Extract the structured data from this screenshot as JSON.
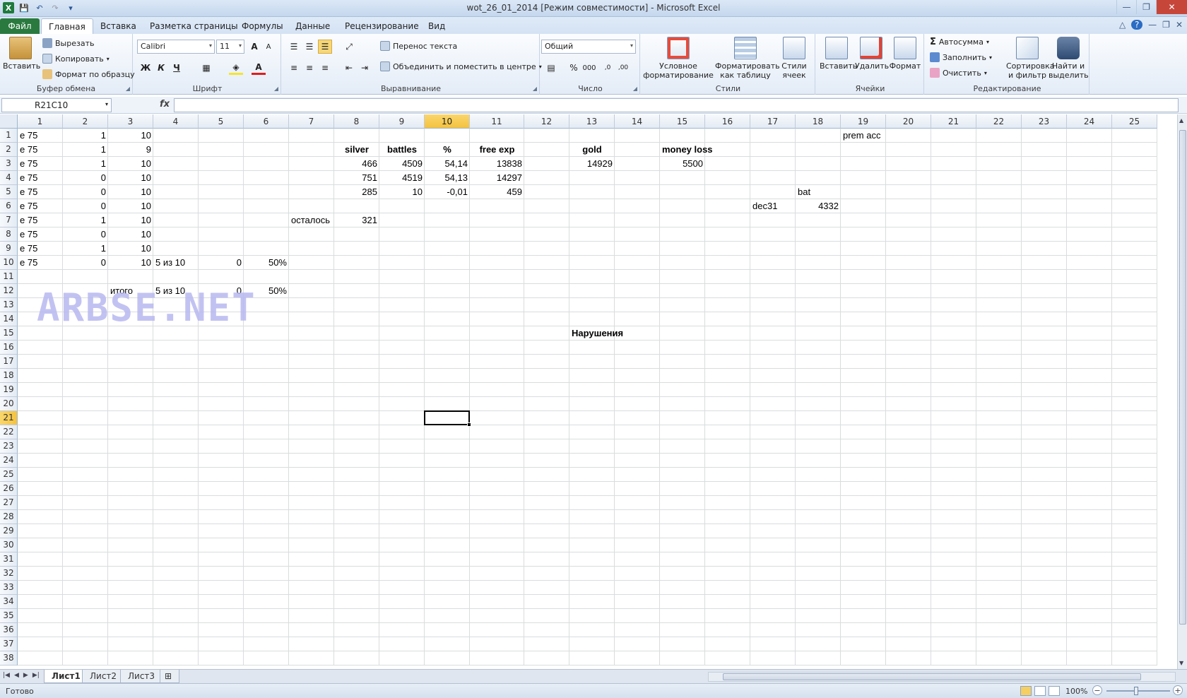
{
  "window": {
    "title": "wot_26_01_2014  [Режим совместимости]  -  Microsoft Excel"
  },
  "qat": {
    "logo": "X",
    "save_icon": "💾",
    "undo_icon": "↶",
    "redo_icon": "↷",
    "customize_icon": "▾"
  },
  "window_buttons": {
    "minimize": "—",
    "maximize": "❐",
    "close": "✕"
  },
  "tabs": [
    "Файл",
    "Главная",
    "Вставка",
    "Разметка страницы",
    "Формулы",
    "Данные",
    "Рецензирование",
    "Вид"
  ],
  "tab_controls": {
    "minimize_ribbon": "△",
    "help": "?",
    "min": "—",
    "restore": "❐",
    "close": "✕"
  },
  "ribbon": {
    "clipboard": {
      "title": "Буфер обмена",
      "paste": "Вставить",
      "cut": "Вырезать",
      "copy": "Копировать",
      "format_painter": "Формат по образцу"
    },
    "font": {
      "title": "Шрифт",
      "name": "Calibri",
      "size": "11",
      "bold": "Ж",
      "italic": "К",
      "underline": "Ч",
      "grow": "A",
      "shrink": "A"
    },
    "alignment": {
      "title": "Выравнивание",
      "wrap": "Перенос текста",
      "merge": "Объединить и поместить в центре"
    },
    "number": {
      "title": "Число",
      "format": "Общий",
      "percent": "%",
      "thousands": "000",
      "inc_decimal": ",0",
      "dec_decimal": ",00"
    },
    "styles": {
      "title": "Стили",
      "conditional": "Условное форматирование",
      "as_table": "Форматировать как таблицу",
      "cell_styles": "Стили ячеек"
    },
    "cells": {
      "title": "Ячейки",
      "insert": "Вставить",
      "delete": "Удалить",
      "format": "Формат"
    },
    "editing": {
      "title": "Редактирование",
      "autosum": "Автосумма",
      "fill": "Заполнить",
      "clear": "Очистить",
      "sort": "Сортировка и фильтр",
      "find": "Найти и выделить"
    }
  },
  "formula_bar": {
    "name_box": "R21C10",
    "fx": "fx",
    "content": ""
  },
  "columns": [
    "1",
    "2",
    "3",
    "4",
    "5",
    "6",
    "7",
    "8",
    "9",
    "10",
    "11",
    "12",
    "13",
    "14",
    "15",
    "16",
    "17",
    "18",
    "19",
    "20",
    "21",
    "22",
    "23",
    "24",
    "25"
  ],
  "rows": [
    "1",
    "2",
    "3",
    "4",
    "5",
    "6",
    "7",
    "8",
    "9",
    "10",
    "11",
    "12",
    "13",
    "14",
    "15",
    "16",
    "17",
    "18",
    "19",
    "20",
    "21",
    "22",
    "23",
    "24",
    "25",
    "26",
    "27",
    "28",
    "29",
    "30",
    "31",
    "32",
    "33",
    "34",
    "35",
    "36",
    "37",
    "38"
  ],
  "selected": {
    "row": "21",
    "col": "10"
  },
  "cells": [
    {
      "r": 1,
      "c": 1,
      "v": "e 75",
      "a": "l"
    },
    {
      "r": 1,
      "c": 2,
      "v": "1",
      "a": "r"
    },
    {
      "r": 1,
      "c": 3,
      "v": "10",
      "a": "r"
    },
    {
      "r": 1,
      "c": 19,
      "v": "prem acc",
      "a": "l"
    },
    {
      "r": 2,
      "c": 1,
      "v": "e 75",
      "a": "l"
    },
    {
      "r": 2,
      "c": 2,
      "v": "1",
      "a": "r"
    },
    {
      "r": 2,
      "c": 3,
      "v": "9",
      "a": "r"
    },
    {
      "r": 2,
      "c": 8,
      "v": "silver",
      "a": "c",
      "b": true
    },
    {
      "r": 2,
      "c": 9,
      "v": "battles",
      "a": "c",
      "b": true
    },
    {
      "r": 2,
      "c": 10,
      "v": "%",
      "a": "c",
      "b": true
    },
    {
      "r": 2,
      "c": 11,
      "v": "free exp",
      "a": "c",
      "b": true
    },
    {
      "r": 2,
      "c": 13,
      "v": "gold",
      "a": "c",
      "b": true
    },
    {
      "r": 2,
      "c": 15,
      "v": "money loss",
      "a": "c",
      "b": true
    },
    {
      "r": 3,
      "c": 1,
      "v": "e 75",
      "a": "l"
    },
    {
      "r": 3,
      "c": 2,
      "v": "1",
      "a": "r"
    },
    {
      "r": 3,
      "c": 3,
      "v": "10",
      "a": "r"
    },
    {
      "r": 3,
      "c": 8,
      "v": "466",
      "a": "r"
    },
    {
      "r": 3,
      "c": 9,
      "v": "4509",
      "a": "r"
    },
    {
      "r": 3,
      "c": 10,
      "v": "54,14",
      "a": "r"
    },
    {
      "r": 3,
      "c": 11,
      "v": "13838",
      "a": "r"
    },
    {
      "r": 3,
      "c": 13,
      "v": "14929",
      "a": "r"
    },
    {
      "r": 3,
      "c": 15,
      "v": "5500",
      "a": "r"
    },
    {
      "r": 4,
      "c": 1,
      "v": "e 75",
      "a": "l"
    },
    {
      "r": 4,
      "c": 2,
      "v": "0",
      "a": "r"
    },
    {
      "r": 4,
      "c": 3,
      "v": "10",
      "a": "r"
    },
    {
      "r": 4,
      "c": 8,
      "v": "751",
      "a": "r"
    },
    {
      "r": 4,
      "c": 9,
      "v": "4519",
      "a": "r"
    },
    {
      "r": 4,
      "c": 10,
      "v": "54,13",
      "a": "r"
    },
    {
      "r": 4,
      "c": 11,
      "v": "14297",
      "a": "r"
    },
    {
      "r": 5,
      "c": 1,
      "v": "e 75",
      "a": "l"
    },
    {
      "r": 5,
      "c": 2,
      "v": "0",
      "a": "r"
    },
    {
      "r": 5,
      "c": 3,
      "v": "10",
      "a": "r"
    },
    {
      "r": 5,
      "c": 8,
      "v": "285",
      "a": "r"
    },
    {
      "r": 5,
      "c": 9,
      "v": "10",
      "a": "r"
    },
    {
      "r": 5,
      "c": 10,
      "v": "-0,01",
      "a": "r"
    },
    {
      "r": 5,
      "c": 11,
      "v": "459",
      "a": "r"
    },
    {
      "r": 5,
      "c": 18,
      "v": "bat",
      "a": "l"
    },
    {
      "r": 6,
      "c": 1,
      "v": "e 75",
      "a": "l"
    },
    {
      "r": 6,
      "c": 2,
      "v": "0",
      "a": "r"
    },
    {
      "r": 6,
      "c": 3,
      "v": "10",
      "a": "r"
    },
    {
      "r": 6,
      "c": 17,
      "v": "dec31",
      "a": "l"
    },
    {
      "r": 6,
      "c": 18,
      "v": "4332",
      "a": "r"
    },
    {
      "r": 7,
      "c": 1,
      "v": "e 75",
      "a": "l"
    },
    {
      "r": 7,
      "c": 2,
      "v": "1",
      "a": "r"
    },
    {
      "r": 7,
      "c": 3,
      "v": "10",
      "a": "r"
    },
    {
      "r": 7,
      "c": 7,
      "v": "осталось",
      "a": "l"
    },
    {
      "r": 7,
      "c": 8,
      "v": "321",
      "a": "r"
    },
    {
      "r": 8,
      "c": 1,
      "v": "e 75",
      "a": "l"
    },
    {
      "r": 8,
      "c": 2,
      "v": "0",
      "a": "r"
    },
    {
      "r": 8,
      "c": 3,
      "v": "10",
      "a": "r"
    },
    {
      "r": 9,
      "c": 1,
      "v": "e 75",
      "a": "l"
    },
    {
      "r": 9,
      "c": 2,
      "v": "1",
      "a": "r"
    },
    {
      "r": 9,
      "c": 3,
      "v": "10",
      "a": "r"
    },
    {
      "r": 10,
      "c": 1,
      "v": "e 75",
      "a": "l"
    },
    {
      "r": 10,
      "c": 2,
      "v": "0",
      "a": "r"
    },
    {
      "r": 10,
      "c": 3,
      "v": "10",
      "a": "r"
    },
    {
      "r": 10,
      "c": 4,
      "v": "5 из 10",
      "a": "l"
    },
    {
      "r": 10,
      "c": 5,
      "v": "0",
      "a": "r"
    },
    {
      "r": 10,
      "c": 6,
      "v": "50%",
      "a": "r"
    },
    {
      "r": 12,
      "c": 3,
      "v": "итого",
      "a": "l"
    },
    {
      "r": 12,
      "c": 4,
      "v": "5 из 10",
      "a": "l"
    },
    {
      "r": 12,
      "c": 5,
      "v": "0",
      "a": "r"
    },
    {
      "r": 12,
      "c": 6,
      "v": "50%",
      "a": "r"
    },
    {
      "r": 15,
      "c": 13,
      "v": "Нарушения",
      "a": "l",
      "b": true
    }
  ],
  "watermark": "ARBSE.NET",
  "sheet_tabs": [
    "Лист1",
    "Лист2",
    "Лист3"
  ],
  "active_sheet": "Лист1",
  "status": {
    "text": "Готово",
    "zoom": "100%"
  },
  "colors": {
    "accent": "#2a7a3f",
    "selected_header": "#f4c23e"
  }
}
